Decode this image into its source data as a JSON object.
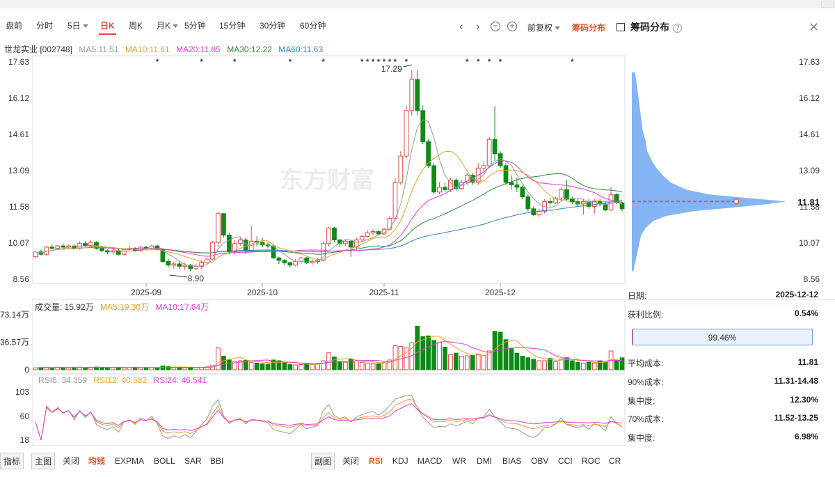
{
  "toolbar": {
    "tabs": [
      {
        "label": "盘前",
        "active": false
      },
      {
        "label": "分时",
        "active": false
      },
      {
        "label": "5日",
        "active": false,
        "dropdown": true
      },
      {
        "label": "日K",
        "active": true
      },
      {
        "label": "周K",
        "active": false
      },
      {
        "label": "月K",
        "active": false,
        "dropdown": true
      },
      {
        "label": "5分钟",
        "active": false
      },
      {
        "label": "15分钟",
        "active": false
      },
      {
        "label": "30分钟",
        "active": false
      },
      {
        "label": "60分钟",
        "active": false
      }
    ],
    "prev_icon": "‹",
    "next_icon": "›",
    "zoom_out_icon": "−",
    "zoom_in_icon": "+",
    "fuquan_label": "前复权",
    "chouma_label": "筹码分布"
  },
  "panel": {
    "title": "筹码分布",
    "help_icon": "?",
    "close_icon": "✕",
    "date_label": "日期:",
    "date_value": "2025-12-12",
    "profit_label": "获利比例:",
    "profit_value": "0.54%",
    "profit_fraction": 0.0054,
    "bar_text": "99.46%",
    "avg_cost_label": "平均成本:",
    "avg_cost_value": "11.81",
    "cost90_label": "90%成本:",
    "cost90_value": "11.31-14.48",
    "conc90_label": "集中度:",
    "conc90_value": "12.30%",
    "cost70_label": "70%成本:",
    "cost70_value": "11.52-13.25",
    "conc70_label": "集中度:",
    "conc70_value": "6.98%",
    "avg_price_tag": "11.81"
  },
  "main_legend": {
    "stock": "世龙实业 [002748]",
    "ma5": "MA5:11.51",
    "ma10": "MA10:11.61",
    "ma20": "MA20:11.85",
    "ma30": "MA30:12.22",
    "ma60": "MA60:11.63"
  },
  "vol_legend": {
    "vol": "成交量: 15.92万",
    "ma5": "MA5:19.30万",
    "ma10": "MA10:17.64万"
  },
  "rsi_legend": {
    "rsi6": "RSI6: 34.359",
    "rsi12": "RSI12: 40.582",
    "rsi24": "RSI24: 46.541"
  },
  "bottom": {
    "indicator": "指标",
    "main": "主图",
    "close1": "关闭",
    "junxian": "均线",
    "expma": "EXPMA",
    "boll": "BOLL",
    "sar": "SAR",
    "bbi": "BBI",
    "sub": "副图",
    "close2": "关闭",
    "rsi": "RSI",
    "kdj": "KDJ",
    "macd": "MACD",
    "wr": "WR",
    "dmi": "DMI",
    "bias": "BIAS",
    "obv": "OBV",
    "cci": "CCI",
    "roc": "ROC",
    "cr": "CR"
  },
  "colors": {
    "up": "#e64545",
    "down": "#0e8a16",
    "ma5": "#999999",
    "ma10": "#e5a022",
    "ma20": "#e53ad6",
    "ma30": "#2e8b3a",
    "ma60": "#2a86c9",
    "chip": "#5b9bf0",
    "accent": "#e8562a"
  },
  "chart_data": {
    "type": "candlestick",
    "price_ticks": [
      "17.63",
      "16.12",
      "14.61",
      "13.09",
      "11.58",
      "10.07",
      "8.56"
    ],
    "ylim": [
      8.56,
      17.63
    ],
    "x_ticks": [
      "2025-09",
      "2025-10",
      "2025-11",
      "2025-12"
    ],
    "high_annotation": "17.29",
    "low_annotation": "8.90",
    "candles": [
      [
        9.5,
        9.7,
        9.45,
        9.72
      ],
      [
        9.7,
        9.6,
        9.55,
        9.8
      ],
      [
        9.6,
        9.9,
        9.55,
        9.95
      ],
      [
        9.9,
        9.85,
        9.8,
        10.0
      ],
      [
        9.85,
        9.95,
        9.8,
        10.0
      ],
      [
        9.95,
        9.9,
        9.85,
        10.05
      ],
      [
        9.9,
        9.95,
        9.85,
        10.0
      ],
      [
        9.95,
        9.85,
        9.8,
        10.0
      ],
      [
        9.85,
        10.05,
        9.8,
        10.15
      ],
      [
        10.05,
        9.95,
        9.9,
        10.15
      ],
      [
        9.95,
        10.1,
        9.9,
        10.2
      ],
      [
        10.1,
        9.85,
        9.8,
        10.15
      ],
      [
        9.85,
        9.75,
        9.7,
        9.9
      ],
      [
        9.75,
        9.7,
        9.6,
        9.8
      ],
      [
        9.7,
        9.75,
        9.6,
        9.85
      ],
      [
        9.75,
        9.6,
        9.55,
        9.85
      ],
      [
        9.6,
        9.8,
        9.55,
        9.85
      ],
      [
        9.8,
        9.85,
        9.75,
        9.95
      ],
      [
        9.85,
        9.75,
        9.7,
        9.9
      ],
      [
        9.75,
        9.9,
        9.7,
        9.95
      ],
      [
        9.9,
        9.85,
        9.8,
        9.95
      ],
      [
        9.85,
        9.95,
        9.8,
        10.0
      ],
      [
        9.95,
        9.8,
        9.75,
        10.0
      ],
      [
        9.8,
        9.3,
        9.25,
        9.85
      ],
      [
        9.3,
        9.15,
        9.05,
        9.4
      ],
      [
        9.15,
        9.2,
        9.0,
        9.3
      ],
      [
        9.2,
        9.1,
        9.0,
        9.3
      ],
      [
        9.1,
        9.15,
        8.95,
        9.25
      ],
      [
        9.15,
        9.0,
        8.9,
        9.2
      ],
      [
        9.0,
        9.1,
        8.95,
        9.2
      ],
      [
        9.1,
        9.25,
        9.0,
        9.35
      ],
      [
        9.25,
        9.4,
        9.2,
        9.45
      ],
      [
        9.4,
        10.1,
        9.35,
        10.15
      ],
      [
        10.1,
        11.3,
        9.9,
        11.35
      ],
      [
        11.3,
        10.4,
        10.3,
        11.3
      ],
      [
        10.4,
        9.7,
        9.6,
        10.5
      ],
      [
        9.7,
        10.05,
        9.6,
        10.2
      ],
      [
        10.05,
        10.2,
        9.95,
        10.3
      ],
      [
        10.2,
        9.75,
        9.6,
        10.3
      ],
      [
        9.75,
        10.15,
        9.7,
        10.8
      ],
      [
        10.15,
        10.1,
        9.95,
        10.35
      ],
      [
        10.1,
        10.0,
        9.9,
        10.3
      ],
      [
        10.0,
        9.95,
        9.85,
        10.1
      ],
      [
        9.95,
        9.45,
        9.4,
        10.05
      ],
      [
        9.45,
        9.35,
        9.2,
        9.5
      ],
      [
        9.35,
        9.25,
        9.15,
        9.4
      ],
      [
        9.25,
        9.15,
        9.05,
        9.3
      ],
      [
        9.15,
        9.3,
        9.1,
        9.4
      ],
      [
        9.3,
        9.45,
        9.2,
        9.5
      ],
      [
        9.45,
        9.25,
        9.2,
        9.5
      ],
      [
        9.25,
        9.3,
        9.15,
        9.4
      ],
      [
        9.3,
        9.35,
        9.2,
        9.45
      ],
      [
        9.35,
        10.05,
        9.3,
        10.1
      ],
      [
        10.05,
        10.7,
        9.95,
        10.75
      ],
      [
        10.7,
        10.2,
        10.1,
        10.75
      ],
      [
        10.2,
        10.05,
        9.9,
        10.25
      ],
      [
        10.05,
        10.15,
        9.95,
        10.2
      ],
      [
        10.15,
        9.9,
        9.5,
        10.2
      ],
      [
        9.9,
        10.2,
        9.8,
        10.3
      ],
      [
        10.2,
        10.35,
        10.1,
        10.4
      ],
      [
        10.35,
        10.5,
        10.3,
        10.6
      ],
      [
        10.5,
        10.55,
        10.4,
        10.65
      ],
      [
        10.55,
        10.45,
        10.4,
        10.6
      ],
      [
        10.45,
        10.65,
        10.4,
        10.7
      ],
      [
        10.65,
        11.1,
        10.6,
        11.2
      ],
      [
        11.1,
        12.6,
        11.0,
        12.8
      ],
      [
        12.6,
        13.7,
        12.5,
        13.9
      ],
      [
        13.7,
        15.6,
        13.6,
        15.8
      ],
      [
        15.6,
        16.9,
        15.4,
        17.29
      ],
      [
        16.9,
        15.6,
        15.4,
        17.29
      ],
      [
        15.6,
        14.3,
        14.2,
        15.8
      ],
      [
        14.3,
        13.3,
        13.2,
        14.4
      ],
      [
        13.3,
        12.2,
        12.1,
        13.4
      ],
      [
        12.2,
        12.4,
        12.1,
        12.6
      ],
      [
        12.4,
        12.3,
        12.2,
        12.6
      ],
      [
        12.3,
        12.7,
        12.2,
        12.8
      ],
      [
        12.7,
        12.35,
        12.25,
        12.8
      ],
      [
        12.35,
        12.6,
        12.3,
        12.7
      ],
      [
        12.6,
        12.9,
        12.5,
        13.0
      ],
      [
        12.9,
        12.6,
        12.5,
        13.0
      ],
      [
        12.6,
        13.2,
        12.5,
        13.4
      ],
      [
        13.2,
        13.3,
        13.0,
        13.5
      ],
      [
        13.3,
        14.4,
        13.2,
        14.5
      ],
      [
        14.4,
        13.8,
        13.5,
        15.8
      ],
      [
        13.8,
        13.3,
        13.2,
        13.9
      ],
      [
        13.3,
        12.6,
        12.5,
        13.4
      ],
      [
        12.6,
        12.5,
        12.3,
        12.9
      ],
      [
        12.5,
        12.4,
        12.2,
        12.8
      ],
      [
        12.4,
        12.0,
        11.9,
        12.5
      ],
      [
        12.0,
        11.5,
        11.4,
        12.1
      ],
      [
        11.5,
        11.25,
        11.2,
        11.6
      ],
      [
        11.25,
        11.4,
        11.15,
        11.5
      ],
      [
        11.4,
        11.8,
        11.3,
        11.9
      ],
      [
        11.8,
        11.75,
        11.6,
        11.95
      ],
      [
        11.75,
        11.95,
        11.7,
        12.0
      ],
      [
        11.95,
        12.3,
        11.8,
        12.4
      ],
      [
        12.3,
        11.9,
        11.85,
        12.7
      ],
      [
        11.9,
        11.8,
        11.7,
        12.0
      ],
      [
        11.8,
        11.7,
        11.6,
        11.9
      ],
      [
        11.7,
        11.8,
        11.25,
        11.9
      ],
      [
        11.8,
        11.6,
        11.5,
        11.9
      ],
      [
        11.6,
        11.8,
        11.3,
        11.9
      ],
      [
        11.8,
        11.7,
        11.6,
        11.9
      ],
      [
        11.7,
        11.45,
        11.4,
        11.8
      ],
      [
        11.45,
        12.1,
        11.4,
        12.4
      ],
      [
        12.1,
        11.75,
        11.7,
        12.15
      ],
      [
        11.75,
        11.5,
        11.4,
        11.8
      ]
    ],
    "volumes": [
      2.5,
      3.0,
      3.2,
      2.8,
      3.4,
      3.0,
      2.6,
      3.1,
      3.5,
      2.9,
      3.3,
      3.6,
      3.0,
      2.8,
      2.7,
      3.1,
      2.6,
      2.9,
      3.2,
      2.8,
      3.0,
      2.7,
      2.5,
      5.0,
      4.2,
      3.5,
      3.0,
      2.8,
      2.6,
      3.0,
      3.3,
      3.8,
      5.5,
      29.0,
      18.0,
      13.0,
      11.0,
      12.0,
      12.5,
      10.0,
      9.0,
      8.0,
      7.5,
      13.0,
      12.0,
      9.5,
      7.0,
      6.5,
      7.0,
      8.0,
      7.0,
      7.5,
      12.0,
      22.5,
      17.0,
      11.0,
      10.0,
      14.0,
      12.0,
      10.0,
      9.0,
      8.5,
      8.0,
      9.5,
      13.0,
      32.0,
      31.0,
      29.0,
      36.0,
      58.0,
      44.0,
      45.0,
      39.0,
      36.0,
      30.0,
      20.0,
      22.0,
      18.0,
      18.5,
      19.0,
      21.0,
      19.0,
      25.0,
      51.0,
      50.0,
      40.0,
      28.0,
      22.0,
      18.0,
      16.0,
      14.0,
      12.0,
      12.0,
      15.0,
      11.0,
      14.0,
      16.0,
      12.0,
      10.0,
      9.0,
      10.0,
      9.0,
      12.0,
      10.0,
      25.0,
      12.0,
      15.92
    ],
    "vol_ticks": [
      "73.14万",
      "36.57万",
      "0"
    ],
    "vol_max": 73.14,
    "rsi_ticks": [
      "103",
      "60",
      "18"
    ],
    "rsi_ylim": [
      18,
      103
    ],
    "chip": {
      "avg_price": 11.81,
      "profile": [
        [
          8.9,
          0.01
        ],
        [
          9.2,
          0.02
        ],
        [
          9.5,
          0.03
        ],
        [
          9.8,
          0.04
        ],
        [
          10.1,
          0.05
        ],
        [
          10.4,
          0.06
        ],
        [
          10.7,
          0.09
        ],
        [
          11.0,
          0.14
        ],
        [
          11.2,
          0.22
        ],
        [
          11.4,
          0.4
        ],
        [
          11.55,
          0.65
        ],
        [
          11.7,
          0.88
        ],
        [
          11.81,
          1.0
        ],
        [
          11.95,
          0.75
        ],
        [
          12.1,
          0.5
        ],
        [
          12.3,
          0.35
        ],
        [
          12.6,
          0.25
        ],
        [
          12.9,
          0.2
        ],
        [
          13.2,
          0.16
        ],
        [
          13.5,
          0.13
        ],
        [
          13.9,
          0.1
        ],
        [
          14.3,
          0.09
        ],
        [
          14.8,
          0.07
        ],
        [
          15.3,
          0.06
        ],
        [
          15.8,
          0.05
        ],
        [
          16.3,
          0.04
        ],
        [
          16.8,
          0.03
        ],
        [
          17.2,
          0.02
        ]
      ]
    }
  }
}
